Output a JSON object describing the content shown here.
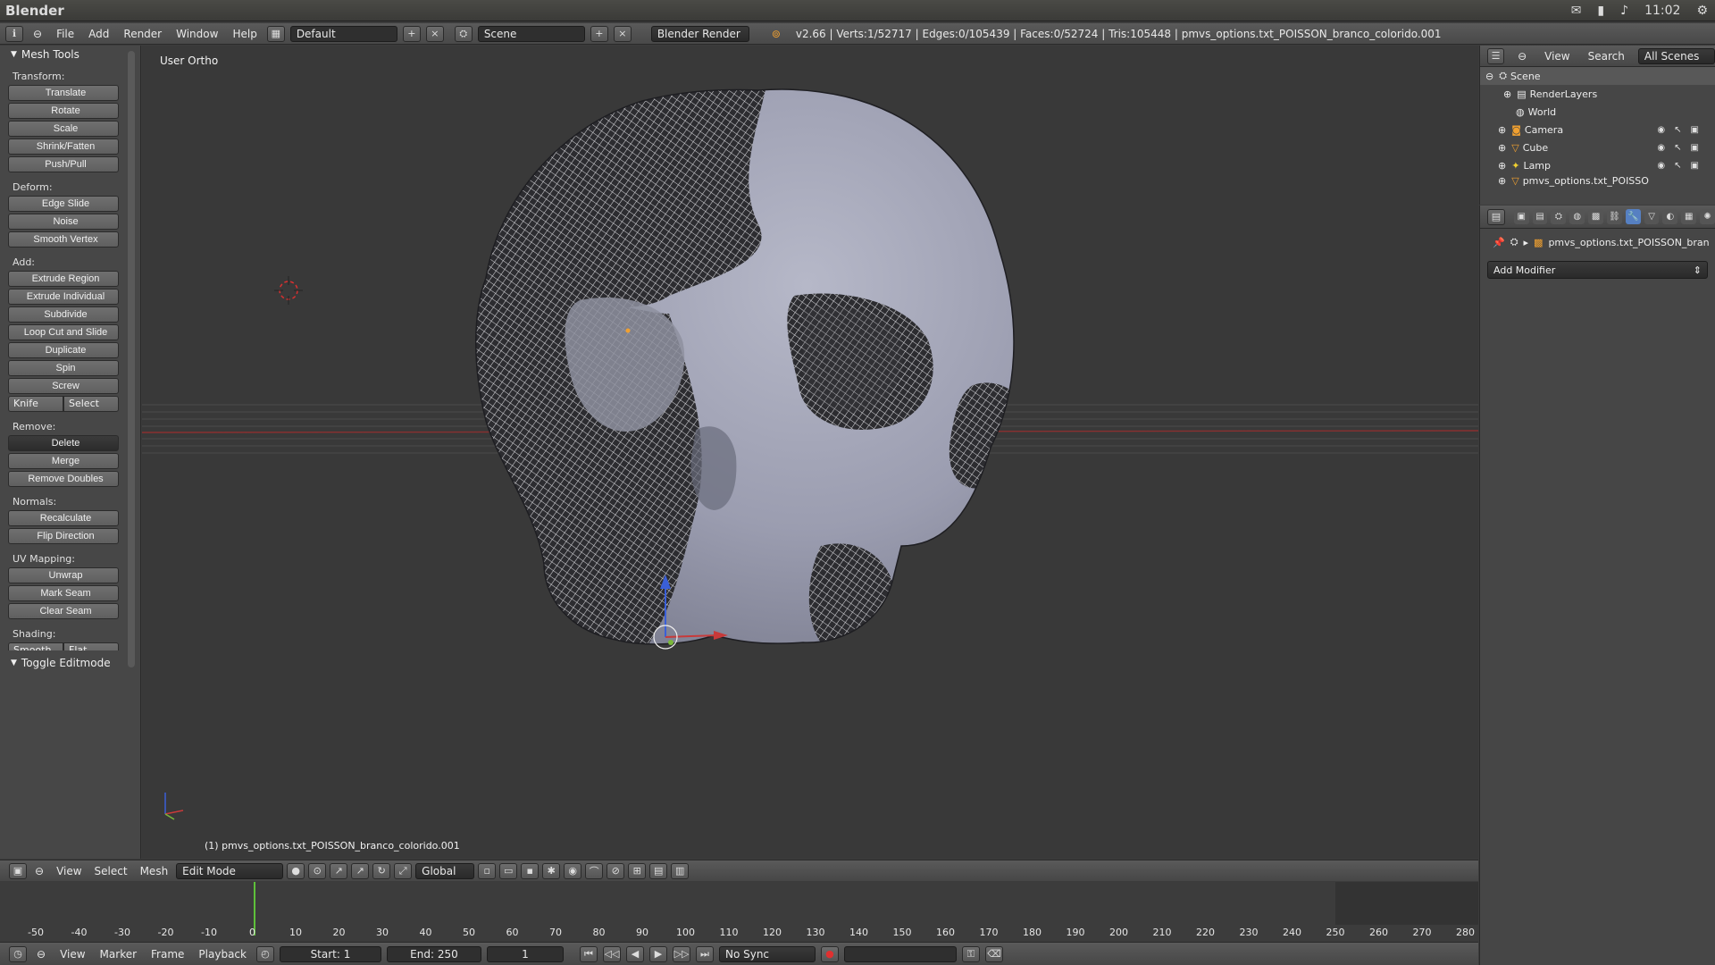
{
  "os": {
    "app_title": "Blender",
    "clock": "11:02"
  },
  "info_header": {
    "menus": [
      "File",
      "Add",
      "Render",
      "Window",
      "Help"
    ],
    "screen_layout": "Default",
    "scene": "Scene",
    "render_engine": "Blender Render",
    "stats": "v2.66 | Verts:1/52717 | Edges:0/105439 | Faces:0/52724 | Tris:105448 | pmvs_options.txt_POISSON_branco_colorido.001"
  },
  "toolshelf": {
    "panel_title": "Mesh Tools",
    "transform_label": "Transform:",
    "transform": [
      "Translate",
      "Rotate",
      "Scale",
      "Shrink/Fatten",
      "Push/Pull"
    ],
    "deform_label": "Deform:",
    "deform": [
      "Edge Slide",
      "Noise",
      "Smooth Vertex"
    ],
    "add_label": "Add:",
    "add": [
      "Extrude Region",
      "Extrude Individual",
      "Subdivide",
      "Loop Cut and Slide",
      "Duplicate",
      "Spin",
      "Screw"
    ],
    "knife": "Knife",
    "knife_select": "Select",
    "remove_label": "Remove:",
    "delete": "Delete",
    "remove": [
      "Merge",
      "Remove Doubles"
    ],
    "normals_label": "Normals:",
    "normals": [
      "Recalculate",
      "Flip Direction"
    ],
    "uv_label": "UV Mapping:",
    "uv": [
      "Unwrap",
      "Mark Seam",
      "Clear Seam"
    ],
    "shading_label": "Shading:",
    "shading_smooth": "Smooth",
    "shading_flat": "Flat",
    "toggle_panel": "Toggle Editmode"
  },
  "viewport": {
    "title": "User Ortho",
    "footer": "(1) pmvs_options.txt_POISSON_branco_colorido.001"
  },
  "view_header": {
    "menus": [
      "View",
      "Select",
      "Mesh"
    ],
    "mode": "Edit Mode",
    "orientation": "Global"
  },
  "timeline": {
    "ticks": [
      "-50",
      "-40",
      "-30",
      "-20",
      "-10",
      "0",
      "10",
      "20",
      "30",
      "40",
      "50",
      "60",
      "70",
      "80",
      "90",
      "100",
      "110",
      "120",
      "130",
      "140",
      "150",
      "160",
      "170",
      "180",
      "190",
      "200",
      "210",
      "220",
      "230",
      "240",
      "250",
      "260",
      "270",
      "280"
    ],
    "menus": [
      "View",
      "Marker",
      "Frame",
      "Playback"
    ],
    "start": "Start: 1",
    "end": "End: 250",
    "current": "1",
    "sync": "No Sync"
  },
  "outliner": {
    "view": "View",
    "search": "Search",
    "scope": "All Scenes",
    "items": [
      "Scene",
      "RenderLayers",
      "World",
      "Camera",
      "Cube",
      "Lamp",
      "pmvs_options.txt_POISSO"
    ]
  },
  "properties": {
    "object_name": "pmvs_options.txt_POISSON_bran",
    "add_modifier": "Add Modifier"
  },
  "colors": {
    "active_tab": "#5680c2",
    "x_axis": "#c83a3a",
    "y_axis": "#7ab83a",
    "z_axis": "#3a5fd8",
    "playhead": "#5ec03a"
  }
}
